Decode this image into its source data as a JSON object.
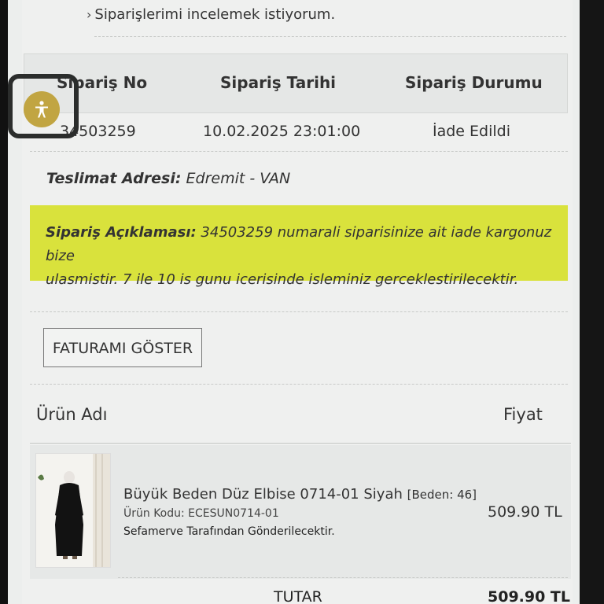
{
  "top_link": {
    "chevron": "›",
    "label": "Siparişlerimi incelemek istiyorum."
  },
  "order_table": {
    "headers": [
      "Sipariş No",
      "Sipariş Tarihi",
      "Sipariş Durumu"
    ],
    "order_no": "34503259",
    "order_date": "10.02.2025 23:01:00",
    "order_status": "İade Edildi"
  },
  "delivery": {
    "label": "Teslimat Adresi:",
    "value": "Edremit - VAN"
  },
  "order_note": {
    "label": "Sipariş Açıklaması:",
    "line1": "34503259 numarali siparisinize ait iade kargonuz bize",
    "line2": "ulasmistir. 7 ile 10 is gunu icerisinde isleminiz gerceklestirilecektir.",
    "highlight_color": "#d9e23c"
  },
  "invoice_button": {
    "label": "FATURAMI GÖSTER"
  },
  "product_table": {
    "headers": {
      "name": "Ürün Adı",
      "price": "Fiyat"
    },
    "items": [
      {
        "name": "Büyük Beden Düz Elbise 0714-01 Siyah",
        "size": "[Beden: 46]",
        "code": "Ürün Kodu: ECESUN0714-01",
        "shipper": "Sefamerve Tarafından Gönderilecektir.",
        "price": "509.90 TL"
      }
    ]
  },
  "total": {
    "label": "TUTAR",
    "value": "509.90 TL"
  },
  "accessibility": {
    "icon": "accessibility-icon",
    "color": "#c1a542"
  }
}
